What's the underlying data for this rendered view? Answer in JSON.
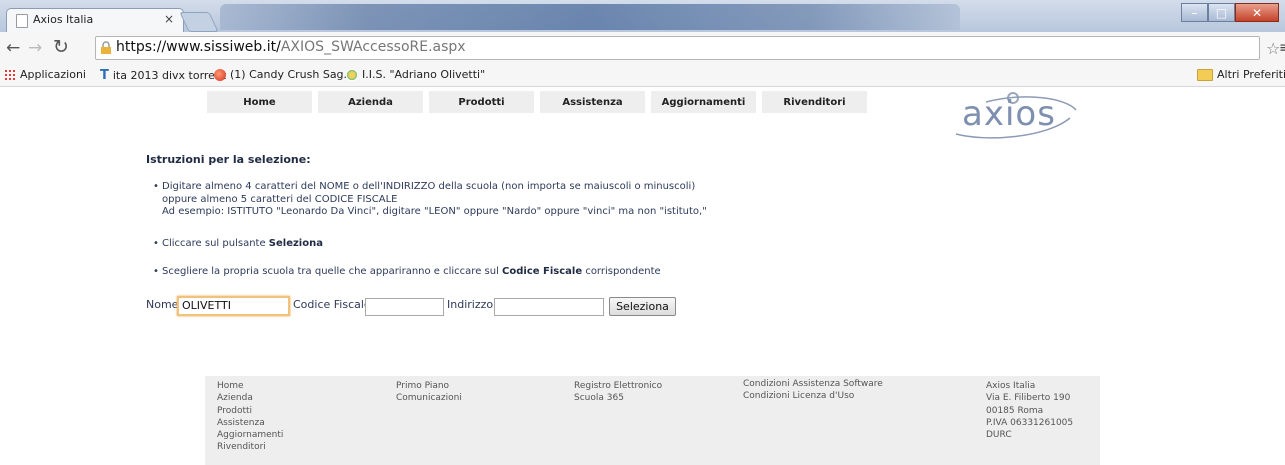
{
  "browser": {
    "tab_title": "Axios Italia",
    "tab_close": "×",
    "url_domain": "https://www.sissiweb.it/",
    "url_path": "AXIOS_SWAccessoRE.aspx",
    "bookmarks": [
      "Applicazioni",
      "ita 2013 divx torrent",
      "(1) Candy Crush Sag...",
      "I.I.S. \"Adriano Olivetti\""
    ],
    "other_bookmarks": "Altri Preferiti"
  },
  "nav": [
    "Home",
    "Azienda",
    "Prodotti",
    "Assistenza",
    "Aggiornamenti",
    "Rivenditori"
  ],
  "logo_text": "axios",
  "instructions": {
    "title": "Istruzioni per la selezione:",
    "b1_l1": "Digitare almeno 4 caratteri del NOME o dell'INDIRIZZO della scuola (non importa se maiuscoli o minuscoli)",
    "b1_l2": "oppure almeno 5 caratteri del CODICE FISCALE",
    "b1_l3": "Ad esempio: ISTITUTO \"Leonardo Da Vinci\", digitare \"LEON\" oppure \"Nardo\" oppure \"vinci\" ma non \"istituto,\"",
    "b2_pre": "Cliccare sul pulsante ",
    "b2_bold": "Seleziona",
    "b3_pre": "Scegliere la propria scuola tra quelle che appariranno e cliccare sul ",
    "b3_bold": "Codice Fiscale",
    "b3_post": " corrispondente"
  },
  "form": {
    "nome_label": "Nome",
    "nome_value": "OLIVETTI",
    "cf_label": "Codice Fiscale",
    "cf_value": "",
    "indirizzo_label": "Indirizzo",
    "indirizzo_value": "",
    "button": "Seleziona"
  },
  "footer": {
    "col1": [
      "Home",
      "Azienda",
      "Prodotti",
      "Assistenza",
      "Aggiornamenti",
      "Rivenditori"
    ],
    "col2": [
      "Primo Piano",
      "Comunicazioni"
    ],
    "col3": [
      "Registro Elettronico",
      "Scuola 365"
    ],
    "col4": [
      "Condizioni Assistenza Software",
      "Condizioni Licenza d'Uso"
    ],
    "col5": [
      "Axios Italia",
      "Via E. Filiberto 190",
      "00185 Roma",
      "P.IVA 06331261005",
      "DURC"
    ]
  }
}
